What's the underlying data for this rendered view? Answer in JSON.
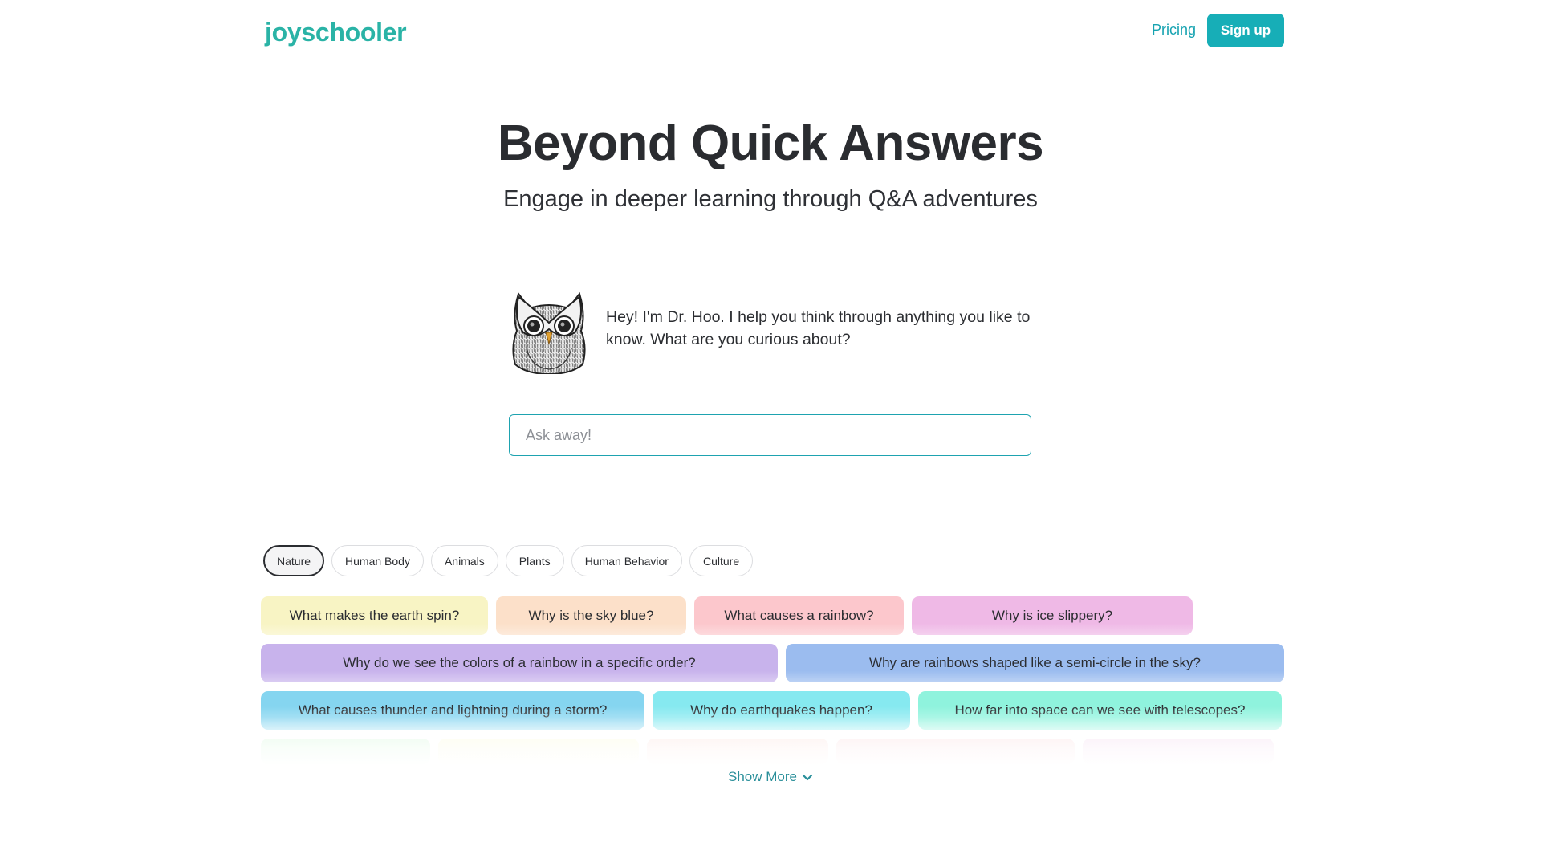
{
  "header": {
    "logo": "joyschooler",
    "nav_pricing": "Pricing",
    "signup_label": "Sign up"
  },
  "hero": {
    "title": "Beyond Quick Answers",
    "subtitle": "Engage in deeper learning through Q&A adventures"
  },
  "assistant": {
    "avatar_icon": "owl-icon",
    "greeting": "Hey! I'm Dr. Hoo. I help you think through anything you like to know. What are you curious about?"
  },
  "ask": {
    "placeholder": "Ask away!",
    "value": ""
  },
  "categories": {
    "active": "Nature",
    "items": [
      "Nature",
      "Human Body",
      "Animals",
      "Plants",
      "Human Behavior",
      "Culture"
    ]
  },
  "questions": {
    "rows": [
      [
        {
          "text": "What makes the earth spin?",
          "color": "#f8f4c4"
        },
        {
          "text": "Why is the sky blue?",
          "color": "#fce0c9"
        },
        {
          "text": "What causes a rainbow?",
          "color": "#fcc7cc"
        },
        {
          "text": "Why is ice slippery?",
          "color": "#efb9e6"
        }
      ],
      [
        {
          "text": "Why do we see the colors of a rainbow in a specific order?",
          "color": "#c8b3ec"
        },
        {
          "text": "Why are rainbows shaped like a semi-circle in the sky?",
          "color": "#9bbcef"
        }
      ],
      [
        {
          "text": "What causes thunder and lightning during a storm?",
          "color": "#85d5f0"
        },
        {
          "text": "Why do earthquakes happen?",
          "color": "#86e9f0"
        },
        {
          "text": "How far into space can we see with telescopes?",
          "color": "#8ff3dd"
        }
      ],
      [
        {
          "text": "",
          "color": "#d8f8dc"
        },
        {
          "text": "",
          "color": "#fbfbdc"
        },
        {
          "text": "",
          "color": "#fde3df"
        },
        {
          "text": "",
          "color": "#fcdfe1"
        },
        {
          "text": "",
          "color": "#f4dbef"
        }
      ]
    ]
  },
  "show_more": {
    "label": "Show More",
    "icon": "chevron-down-icon"
  }
}
